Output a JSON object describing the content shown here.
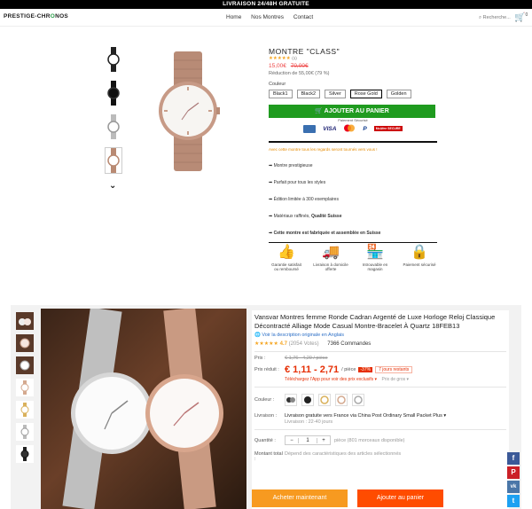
{
  "topbar": {
    "text": "LIVRAISON 24/48H GRATUITE"
  },
  "nav": {
    "logo_a": "PRESTIGE-CHR",
    "logo_b": "O",
    "logo_c": "NOS",
    "items": [
      "Home",
      "Nos Montres",
      "Contact"
    ],
    "search_placeholder": "Recherche..."
  },
  "product1": {
    "title": "MONTRE \"CLASS\"",
    "rating_count": "(1)",
    "price_now": "15,00€",
    "price_old": "70,00€",
    "reduction": "Réduction de 55,00€ (79 %)",
    "color_label": "Couleur",
    "colors": [
      "Black1",
      "Black2",
      "Silver",
      "Rose Gold",
      "Golden"
    ],
    "selected_color": "Rose Gold",
    "add_to_cart": "AJOUTER AU PANIER",
    "secure_text": "Paiement Sécurisé",
    "payments": [
      "VISA",
      "McAfee SECURE"
    ],
    "promo": "Avec cette montre tous les regards seront tournés vers vous !",
    "features": [
      "➡ Montre prestigieuse",
      "➡ Parfait pour tous les styles",
      "➡ Édition limitée à 300 exemplaires"
    ],
    "feature_material_a": "➡ Matériaux raffinés, ",
    "feature_material_b": "Qualité Suisse",
    "feature_swiss": "➡ Cette montre est fabriquée et assemblée en Suisse",
    "badges": [
      {
        "icon": "thumbs-up-icon",
        "label": "Garantie satisfait ou remboursé"
      },
      {
        "icon": "truck-icon",
        "label": "Livraison à domicile offerte"
      },
      {
        "icon": "store-icon",
        "label": "Introuvable en magasin"
      },
      {
        "icon": "lock-icon",
        "label": "Paiement sécurisé"
      }
    ]
  },
  "product2": {
    "title": "Vansvar Montres femme Ronde Cadran Argenté de Luxe Horloge Reloj Classique Décontracté Alliage Mode Casual Montre-Bracelet À Quartz 18FEB13",
    "original_link": "Voir la description originale en Anglais",
    "rating_value": "4.7",
    "rating_votes": "(2054 Votes)",
    "orders": "7366 Commandes",
    "price_label": "Prix :",
    "price_old": "€ 1,76 - 4,29 / pièce",
    "reduced_label": "Prix réduit :",
    "price_range": "€ 1,11 - 2,71",
    "unit": "/ pièce",
    "discount": "-37%",
    "days_left": "7 jours restants",
    "app_promo": "Téléchargez l'App pour voir des prix exclusifs ▾",
    "bulk_price": "Prix de gros ▾",
    "color_label": "Couleur :",
    "shipping_label": "Livraison :",
    "shipping_text": "Livraison gratuite vers France via China Post Ordinary Small Packet Plus ▾",
    "shipping_delay": "Livraison : 22-40 jours",
    "qty_label": "Quantité :",
    "qty_value": "1",
    "qty_available": "pièce (801 morceaux disponible)",
    "total_label": "Montant total :",
    "total_text": "Dépend des caractéristiques des articles sélectionnés",
    "buy_now": "Acheter maintenant",
    "add_to_cart": "Ajouter au panier"
  },
  "social": [
    {
      "name": "facebook-icon",
      "color": "#3b5998",
      "glyph": "f"
    },
    {
      "name": "pinterest-icon",
      "color": "#cb2027",
      "glyph": "P"
    },
    {
      "name": "vk-icon",
      "color": "#4a76a8",
      "glyph": "vk"
    },
    {
      "name": "twitter-icon",
      "color": "#1da1f2",
      "glyph": "t"
    }
  ],
  "colors": {
    "green": "#1f9b1f",
    "orange": "#f79a20",
    "red": "#e62e04",
    "star": "#f5a623"
  }
}
